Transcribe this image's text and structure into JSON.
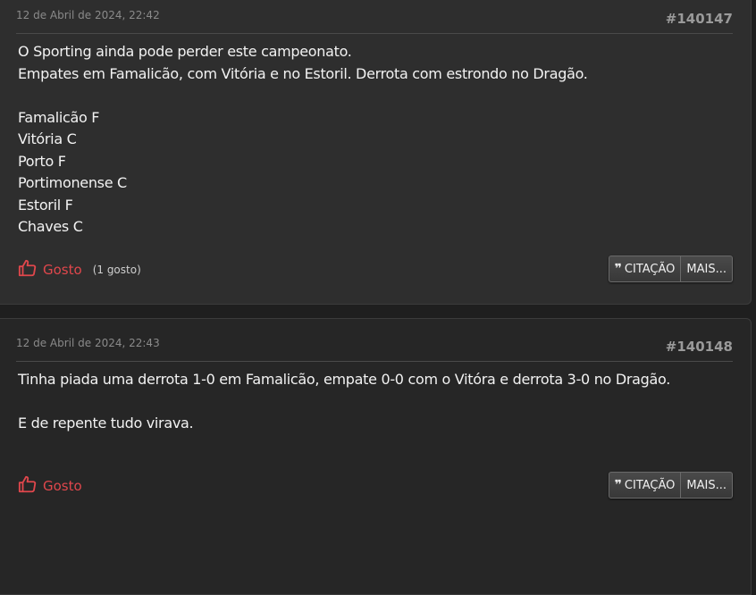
{
  "posts": [
    {
      "date": "12 de Abril de 2024, 22:42",
      "number": "#140147",
      "lines": [
        "O Sporting ainda pode perder este campeonato.",
        "Empates em Famalicão, com Vitória e no Estoril. Derrota com estrondo no Dragão.",
        "",
        "Famalicão F",
        "Vitória C",
        "Porto F",
        "Portimonense C",
        "Estoril F",
        "Chaves C"
      ],
      "like_label": "Gosto",
      "like_count": "(1 gosto)",
      "quote_label": "CITAÇÃO",
      "more_label": "MAIS..."
    },
    {
      "date": "12 de Abril de 2024, 22:43",
      "number": "#140148",
      "lines": [
        "Tinha piada uma derrota 1-0 em Famalicão, empate 0-0 com o Vitóra e derrota 3-0 no Dragão.",
        "",
        "E de repente tudo virava."
      ],
      "like_label": "Gosto",
      "quote_label": "CITAÇÃO",
      "more_label": "MAIS..."
    }
  ],
  "colors": {
    "like": "#e0474c",
    "background": "#1f1f1f"
  },
  "icons": {
    "like": "thumbs-up-icon",
    "quote": "quote-icon"
  }
}
